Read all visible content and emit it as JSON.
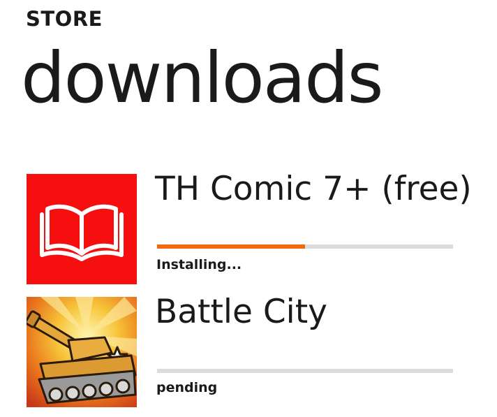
{
  "header": {
    "app_label": "STORE",
    "title": "downloads"
  },
  "downloads": [
    {
      "name": "TH Comic 7+ (free)",
      "status": "Installing...",
      "progress": 0.5,
      "tile_color": "#f50f0f",
      "icon": "open-book-icon"
    },
    {
      "name": "Battle City",
      "status": "pending",
      "progress": 0,
      "icon": "tank-game-icon"
    }
  ],
  "colors": {
    "accent": "#f06a0f",
    "track": "#dcdcdc",
    "text": "#1a1a1a",
    "background": "#ffffff"
  }
}
